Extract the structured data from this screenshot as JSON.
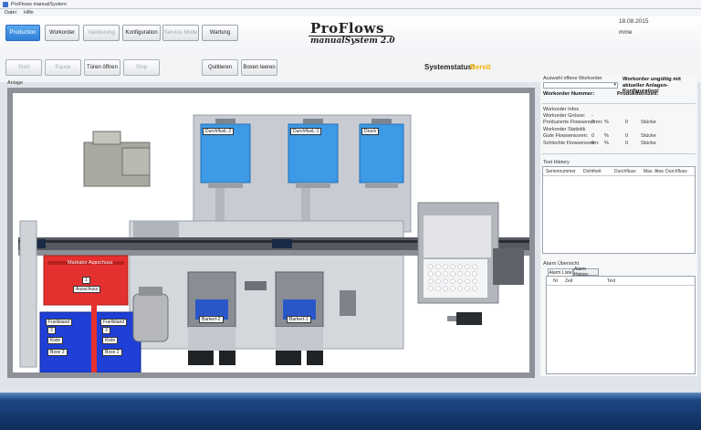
{
  "window": {
    "title": "ProFlows manualSystem"
  },
  "menu": [
    "Datei",
    "Hilfe"
  ],
  "tabs": [
    {
      "label": "Production",
      "state": "active"
    },
    {
      "label": "Workorder",
      "state": "normal"
    },
    {
      "label": "Validierung",
      "state": "disabled"
    },
    {
      "label": "Konfiguration",
      "state": "normal"
    },
    {
      "label": "Service Mode",
      "state": "disabled"
    },
    {
      "label": "Wartung",
      "state": "normal"
    }
  ],
  "logo": {
    "line1": "ProFlows",
    "line2": "manualSystem 2.0"
  },
  "header": {
    "date": "18.08.2015",
    "user": "mme"
  },
  "controls": {
    "start": "Start",
    "pause": "Pause",
    "open_doors": "Türen öffnen",
    "stop": "Stop",
    "acknowledge": "Quittieren",
    "empty_boxes": "Boxen leeren"
  },
  "status": {
    "label": "Systemstatus:",
    "value": "Bereit",
    "color": "#f0b400"
  },
  "plant": {
    "label": "Anlage",
    "stations": [
      "DurchfluxL-2",
      "DurchfluxL-1",
      "Druck"
    ],
    "stations_lower": [
      "Barkert-2",
      "Barkert-1"
    ],
    "marker_title": "Markator Ausschuss",
    "marker_count": "1",
    "marker_text": "Ausschuss",
    "box3": {
      "label": "Fuellstand",
      "count": "3",
      "unit": "Kiste",
      "name": "Boxe 3"
    },
    "box2": {
      "label": "Fuellstand",
      "count": "3",
      "unit": "Kiste",
      "name": "Boxe 2"
    }
  },
  "right": {
    "select_label": "Auswahl offene Workorder",
    "warning": "Workorder ungültig mit aktueller Anlagen-Konfiguration!",
    "workorder_number": "Workorder Nummer:",
    "production_count": "Produktionszeit:",
    "info_title": "Workorder Infos",
    "info_rows": [
      {
        "label": "Workorder Grösse:",
        "a": "-",
        "b": "",
        "c": "",
        "d": ""
      },
      {
        "label": "Produzierte Flowsensoren:",
        "a": "0",
        "b": "%",
        "c": "0",
        "d": "Stücke"
      }
    ],
    "stats_title": "Workorder Statistik",
    "stats_rows": [
      {
        "label": "Gute Flowsensoren:",
        "a": "0",
        "b": "%",
        "c": "0",
        "d": "Stücke"
      },
      {
        "label": "Schlechte Flowsensoren:",
        "a": "0",
        "b": "%",
        "c": "0",
        "d": "Stücke"
      }
    ],
    "test_history_title": "Test History",
    "test_columns": [
      "Seriennummer",
      "Dichtheit",
      "Durchfluss",
      "Max. Abw. Durchfluss"
    ],
    "alarm_title": "Alarm Übersicht",
    "alarm_tabs": [
      "Alarm Liste",
      "Alarm History"
    ],
    "alarm_columns": [
      "Nr",
      "Zeit",
      "Text"
    ]
  }
}
